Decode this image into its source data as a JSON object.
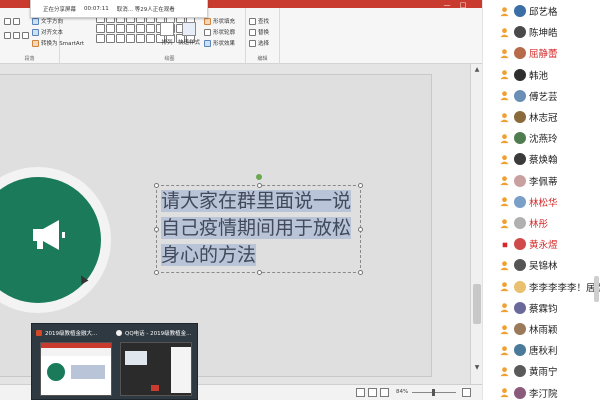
{
  "share_bar": {
    "status": "正在分享屏幕",
    "time": "00:07:11",
    "viewers": "取消... 等29人正在观看"
  },
  "ribbon": {
    "text_direction": "文字方向",
    "align_text": "对齐文本",
    "convert_smartart": "转换为 SmartArt",
    "arrange": "排列",
    "quick_styles": "快速样式",
    "shape_fill": "形状填充",
    "shape_outline": "形状轮廓",
    "shape_effects": "形状效果",
    "find": "查找",
    "replace": "替换",
    "select": "选择",
    "group_paragraph": "段落",
    "group_drawing": "绘图",
    "group_editing": "编辑"
  },
  "slide": {
    "lines": [
      "请大家在群里面说一说",
      "自己疫情期间用于放松",
      "身心的方法"
    ]
  },
  "status_bar": {
    "zoom": "84%"
  },
  "previews": [
    {
      "title": "2019级教植金融大..."
    },
    {
      "title": "QQ电话 - 2019级教植金..."
    }
  ],
  "members": [
    {
      "name": "邱艺格",
      "color": "normal",
      "avatar": "#3a6ea5"
    },
    {
      "name": "陈坤皓",
      "color": "normal",
      "avatar": "#4a4a4a"
    },
    {
      "name": "屈静蕾",
      "color": "red",
      "avatar": "#b76a4a"
    },
    {
      "name": "韩池",
      "color": "normal",
      "avatar": "#2e2e2e"
    },
    {
      "name": "傅艺芸",
      "color": "normal",
      "avatar": "#6a8fb7"
    },
    {
      "name": "林志冠",
      "color": "normal",
      "avatar": "#8a6a3a"
    },
    {
      "name": "沈燕玲",
      "color": "normal",
      "avatar": "#4f7d4f"
    },
    {
      "name": "蔡焕翰",
      "color": "normal",
      "avatar": "#3b3b3b"
    },
    {
      "name": "李佩蒂",
      "color": "normal",
      "avatar": "#c9a0a0"
    },
    {
      "name": "林松华",
      "color": "red",
      "avatar": "#7aa0c8"
    },
    {
      "name": "林彤",
      "color": "red",
      "avatar": "#b0b0b0"
    },
    {
      "name": "黄永煜",
      "color": "red",
      "avatar": "#d04a4a"
    },
    {
      "name": "吴锦林",
      "color": "normal",
      "avatar": "#555555"
    },
    {
      "name": "李李李李李！居然",
      "color": "normal",
      "avatar": "#e8c070"
    },
    {
      "name": "蔡霖钧",
      "color": "normal",
      "avatar": "#6a6a9a"
    },
    {
      "name": "林雨颖",
      "color": "normal",
      "avatar": "#9a7a5a"
    },
    {
      "name": "唐秋利",
      "color": "normal",
      "avatar": "#4a7a9a"
    },
    {
      "name": "黄雨宁",
      "color": "normal",
      "avatar": "#5a5a5a"
    },
    {
      "name": "李汀院",
      "color": "normal",
      "avatar": "#8a5a7a"
    }
  ]
}
